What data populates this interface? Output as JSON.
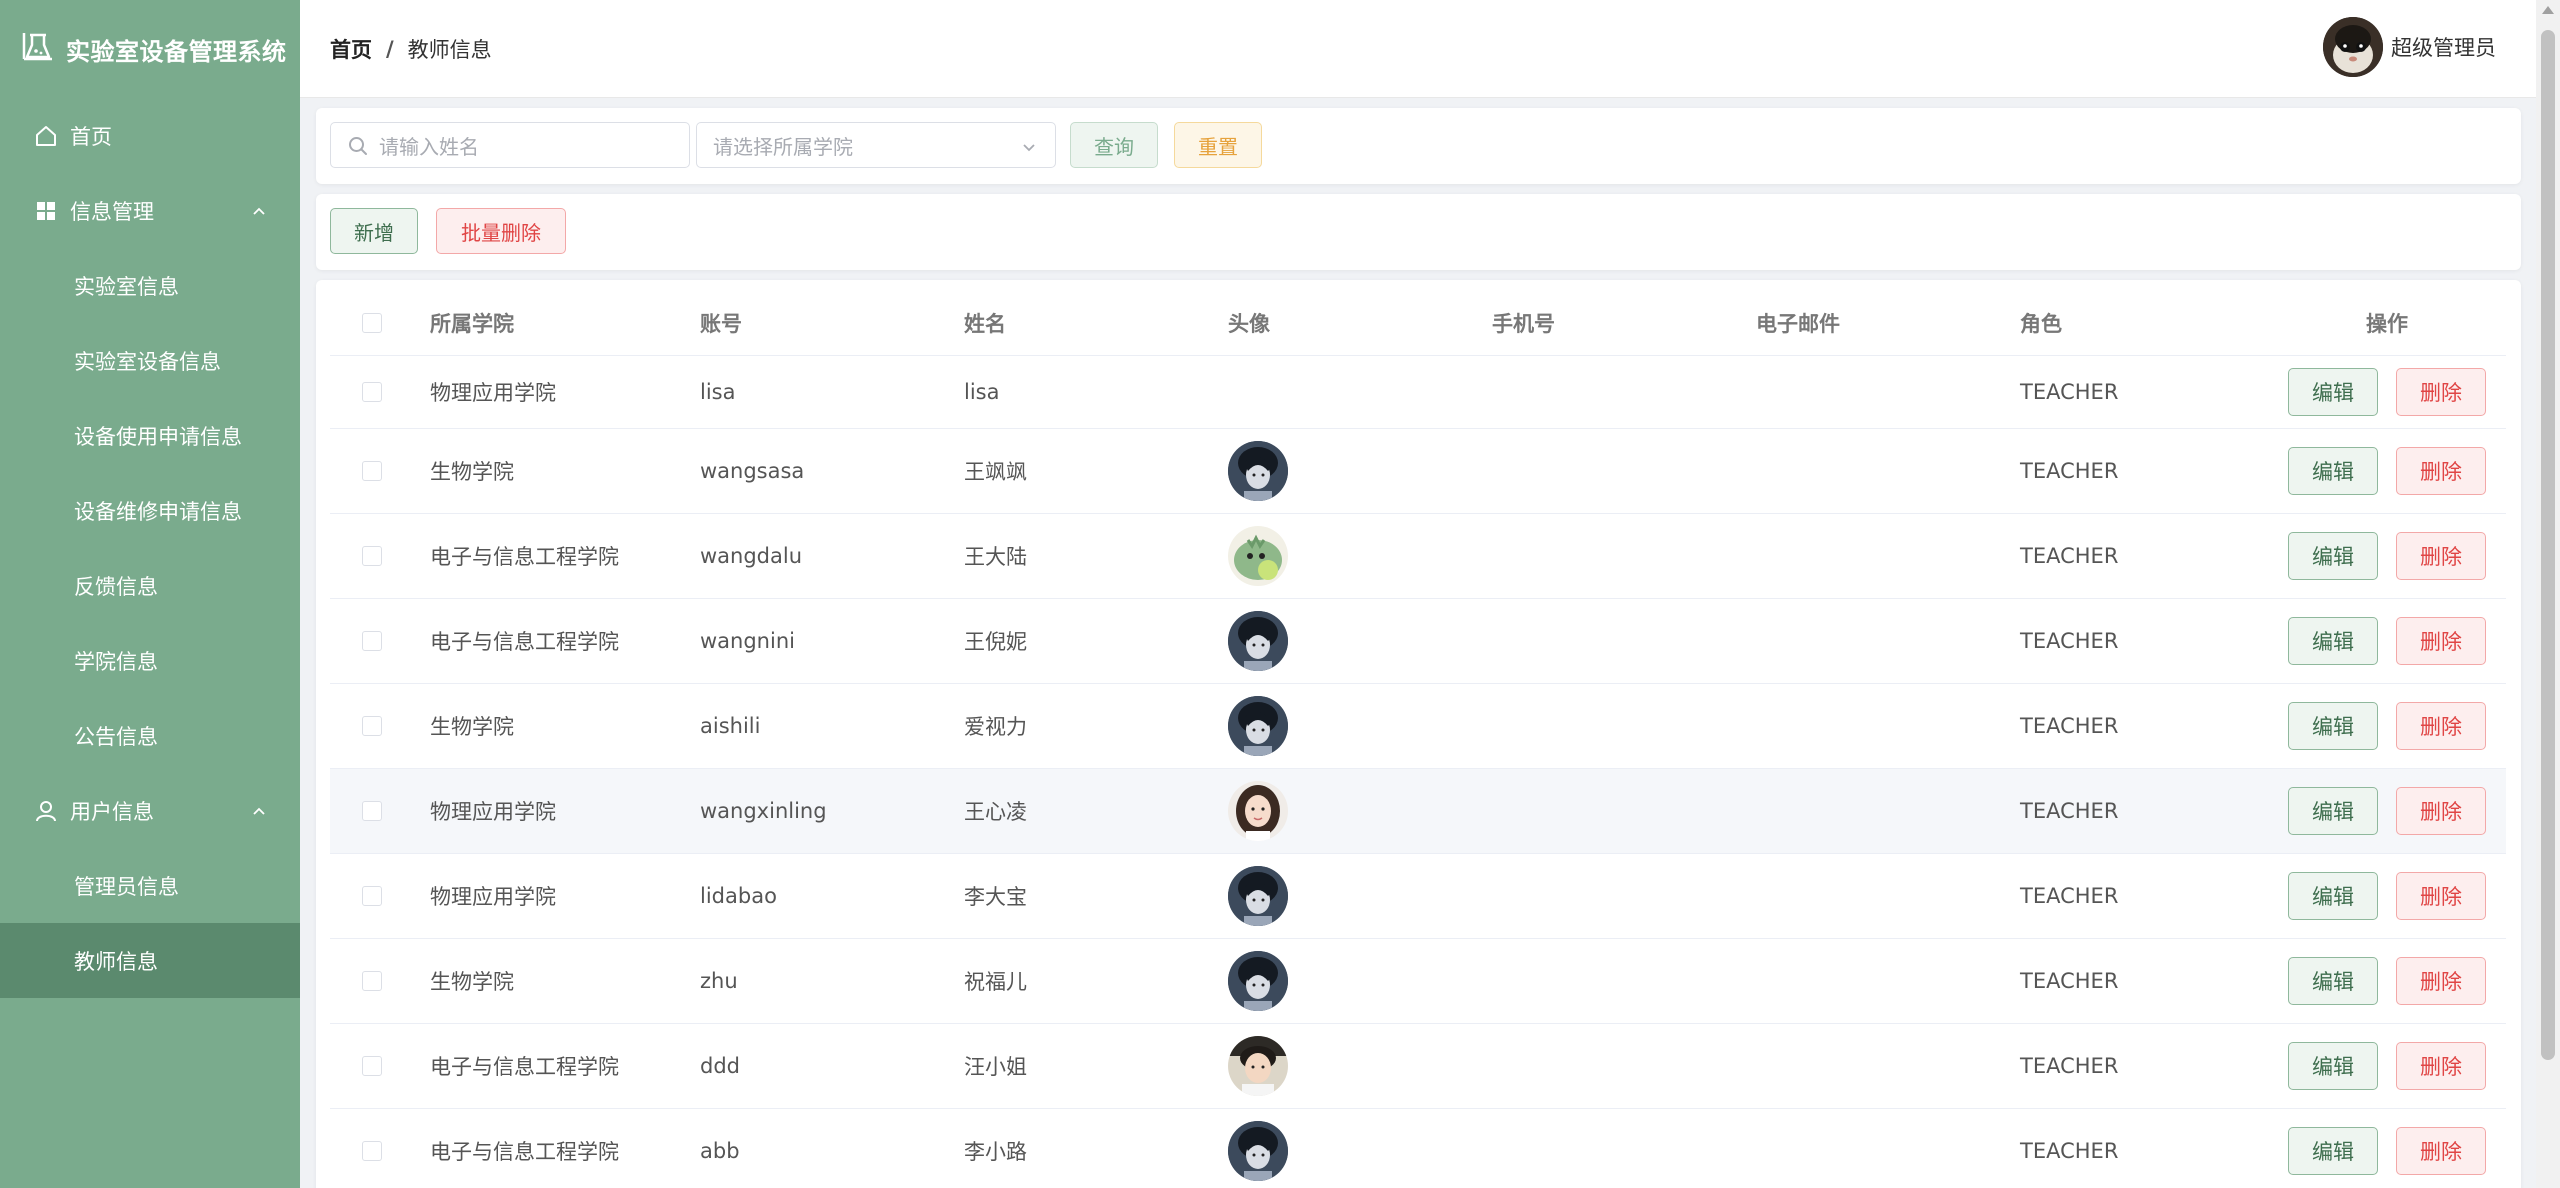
{
  "app": {
    "title": "实验室设备管理系统"
  },
  "sidebar": {
    "items": [
      {
        "label": "首页",
        "icon": "home-icon"
      },
      {
        "label": "信息管理",
        "icon": "grid-icon"
      },
      {
        "label": "实验室信息"
      },
      {
        "label": "实验室设备信息"
      },
      {
        "label": "设备使用申请信息"
      },
      {
        "label": "设备维修申请信息"
      },
      {
        "label": "反馈信息"
      },
      {
        "label": "学院信息"
      },
      {
        "label": "公告信息"
      },
      {
        "label": "用户信息",
        "icon": "user-icon"
      },
      {
        "label": "管理员信息"
      },
      {
        "label": "教师信息"
      }
    ],
    "active_index": 11
  },
  "header": {
    "breadcrumb_home": "首页",
    "breadcrumb_sep": "/",
    "breadcrumb_current": "教师信息",
    "user_name": "超级管理员"
  },
  "search": {
    "name_placeholder": "请输入姓名",
    "college_placeholder": "请选择所属学院",
    "query_label": "查询",
    "reset_label": "重置"
  },
  "actions": {
    "add_label": "新增",
    "batch_delete_label": "批量删除"
  },
  "table": {
    "columns": [
      "所属学院",
      "账号",
      "姓名",
      "头像",
      "手机号",
      "电子邮件",
      "角色",
      "操作"
    ],
    "edit_label": "编辑",
    "delete_label": "删除",
    "rows": [
      {
        "college": "物理应用学院",
        "account": "lisa",
        "name": "lisa",
        "avatar": "",
        "phone": "",
        "email": "",
        "role": "TEACHER"
      },
      {
        "college": "生物学院",
        "account": "wangsasa",
        "name": "王飒飒",
        "avatar": "dark-hair-avatar",
        "phone": "",
        "email": "",
        "role": "TEACHER"
      },
      {
        "college": "电子与信息工程学院",
        "account": "wangdalu",
        "name": "王大陆",
        "avatar": "green-cartoon-avatar",
        "phone": "",
        "email": "",
        "role": "TEACHER"
      },
      {
        "college": "电子与信息工程学院",
        "account": "wangnini",
        "name": "王倪妮",
        "avatar": "dark-hair-avatar",
        "phone": "",
        "email": "",
        "role": "TEACHER"
      },
      {
        "college": "生物学院",
        "account": "aishili",
        "name": "爱视力",
        "avatar": "dark-hair-avatar",
        "phone": "",
        "email": "",
        "role": "TEACHER"
      },
      {
        "college": "物理应用学院",
        "account": "wangxinling",
        "name": "王心凌",
        "avatar": "girl-avatar",
        "phone": "",
        "email": "",
        "role": "TEACHER"
      },
      {
        "college": "物理应用学院",
        "account": "lidabao",
        "name": "李大宝",
        "avatar": "dark-hair-avatar",
        "phone": "",
        "email": "",
        "role": "TEACHER"
      },
      {
        "college": "生物学院",
        "account": "zhu",
        "name": "祝福儿",
        "avatar": "dark-hair-avatar",
        "phone": "",
        "email": "",
        "role": "TEACHER"
      },
      {
        "college": "电子与信息工程学院",
        "account": "ddd",
        "name": "汪小姐",
        "avatar": "boy-photo-avatar",
        "phone": "",
        "email": "",
        "role": "TEACHER"
      },
      {
        "college": "电子与信息工程学院",
        "account": "abb",
        "name": "李小路",
        "avatar": "dark-hair-avatar",
        "phone": "",
        "email": "",
        "role": "TEACHER"
      }
    ],
    "highlighted_row": 5
  },
  "colors": {
    "sidebar_bg": "#7aab8d",
    "sidebar_active": "#5b8a6e",
    "accent_green": "#3e6e4e",
    "danger_red": "#e04545",
    "warning_orange": "#e6a23c"
  }
}
